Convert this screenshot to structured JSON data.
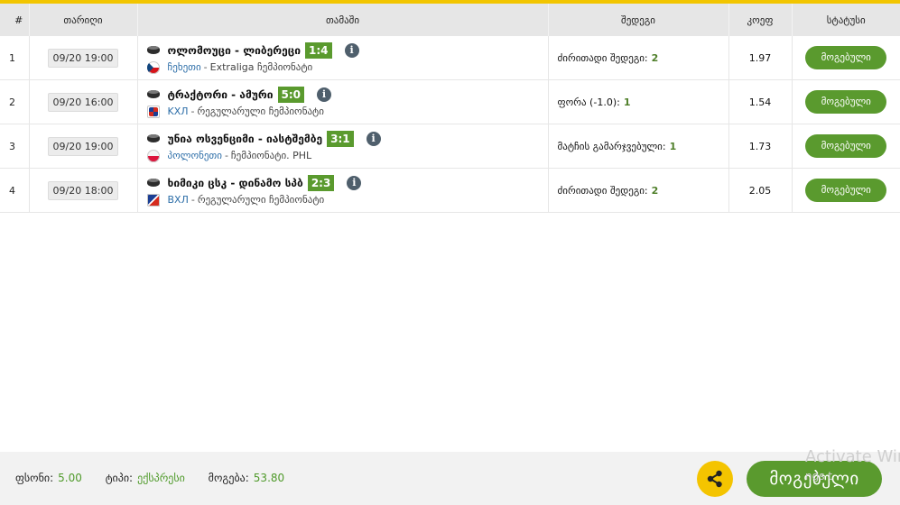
{
  "table": {
    "headers": {
      "num": "#",
      "date": "თარიღი",
      "match": "თამაში",
      "market": "შედეგი",
      "odds": "კოეფ",
      "status": "სტატუსი"
    },
    "rows": [
      {
        "num": "1",
        "date": "09/20 19:00",
        "teams": "ოლომოუცი - ლიბერეცი",
        "score": "1:4",
        "country": "ჩეხეთი",
        "league": "Extraliga ჩემპიონატი",
        "market_label": "ძირითადი შედეგი:",
        "market_value": "2",
        "odds": "1.97",
        "status": "მოგებული"
      },
      {
        "num": "2",
        "date": "09/20 16:00",
        "teams": "ტრაქტორი - ამური",
        "score": "5:0",
        "country": "KXЛ",
        "league": "რეგულარული ჩემპიონატი",
        "market_label": "ფორა (-1.0):",
        "market_value": "1",
        "odds": "1.54",
        "status": "მოგებული"
      },
      {
        "num": "3",
        "date": "09/20 19:00",
        "teams": "უნია ოსვენციმი - იასტშემბე",
        "score": "3:1",
        "country": "პოლონეთი",
        "league": "ჩემპიონატი. PHL",
        "market_label": "მატჩის გამარჯვებული:",
        "market_value": "1",
        "odds": "1.73",
        "status": "მოგებული"
      },
      {
        "num": "4",
        "date": "09/20 18:00",
        "teams": "ხიმიკი ცსკ - დინამო სპბ",
        "score": "2:3",
        "country": "BXЛ",
        "league": "რეგულარული ჩემპიონატი",
        "market_label": "ძირითადი შედეგი:",
        "market_value": "2",
        "odds": "2.05",
        "status": "მოგებული"
      }
    ]
  },
  "footer": {
    "stake_label": "ფსონი:",
    "stake_value": "5.00",
    "type_label": "ტიპი:",
    "type_value": "ექსპრესი",
    "win_label": "მოგება:",
    "win_value": "53.80",
    "won_button": "მოგებული"
  },
  "watermark": {
    "line1": "Activate Wir",
    "line2": "ngs t"
  },
  "icons": {
    "info": "i"
  },
  "colors": {
    "accent_yellow": "#f2c500",
    "win_green": "#5a9a2e",
    "link_blue": "#2d6ea8"
  }
}
